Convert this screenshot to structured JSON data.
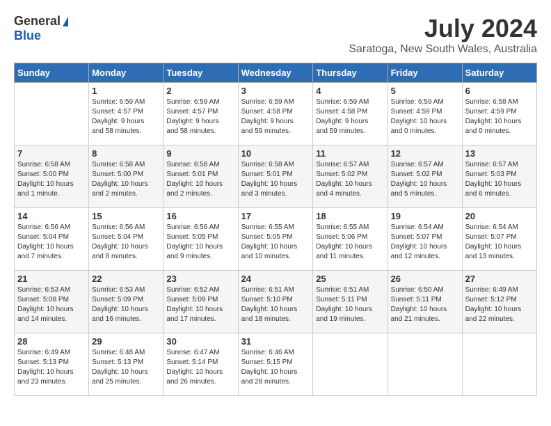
{
  "logo": {
    "general": "General",
    "blue": "Blue"
  },
  "title": {
    "month_year": "July 2024",
    "location": "Saratoga, New South Wales, Australia"
  },
  "days_header": [
    "Sunday",
    "Monday",
    "Tuesday",
    "Wednesday",
    "Thursday",
    "Friday",
    "Saturday"
  ],
  "weeks": [
    [
      {
        "day": "",
        "info": ""
      },
      {
        "day": "1",
        "info": "Sunrise: 6:59 AM\nSunset: 4:57 PM\nDaylight: 9 hours\nand 58 minutes."
      },
      {
        "day": "2",
        "info": "Sunrise: 6:59 AM\nSunset: 4:57 PM\nDaylight: 9 hours\nand 58 minutes."
      },
      {
        "day": "3",
        "info": "Sunrise: 6:59 AM\nSunset: 4:58 PM\nDaylight: 9 hours\nand 59 minutes."
      },
      {
        "day": "4",
        "info": "Sunrise: 6:59 AM\nSunset: 4:58 PM\nDaylight: 9 hours\nand 59 minutes."
      },
      {
        "day": "5",
        "info": "Sunrise: 6:59 AM\nSunset: 4:59 PM\nDaylight: 10 hours\nand 0 minutes."
      },
      {
        "day": "6",
        "info": "Sunrise: 6:58 AM\nSunset: 4:59 PM\nDaylight: 10 hours\nand 0 minutes."
      }
    ],
    [
      {
        "day": "7",
        "info": "Sunrise: 6:58 AM\nSunset: 5:00 PM\nDaylight: 10 hours\nand 1 minute."
      },
      {
        "day": "8",
        "info": "Sunrise: 6:58 AM\nSunset: 5:00 PM\nDaylight: 10 hours\nand 2 minutes."
      },
      {
        "day": "9",
        "info": "Sunrise: 6:58 AM\nSunset: 5:01 PM\nDaylight: 10 hours\nand 2 minutes."
      },
      {
        "day": "10",
        "info": "Sunrise: 6:58 AM\nSunset: 5:01 PM\nDaylight: 10 hours\nand 3 minutes."
      },
      {
        "day": "11",
        "info": "Sunrise: 6:57 AM\nSunset: 5:02 PM\nDaylight: 10 hours\nand 4 minutes."
      },
      {
        "day": "12",
        "info": "Sunrise: 6:57 AM\nSunset: 5:02 PM\nDaylight: 10 hours\nand 5 minutes."
      },
      {
        "day": "13",
        "info": "Sunrise: 6:57 AM\nSunset: 5:03 PM\nDaylight: 10 hours\nand 6 minutes."
      }
    ],
    [
      {
        "day": "14",
        "info": "Sunrise: 6:56 AM\nSunset: 5:04 PM\nDaylight: 10 hours\nand 7 minutes."
      },
      {
        "day": "15",
        "info": "Sunrise: 6:56 AM\nSunset: 5:04 PM\nDaylight: 10 hours\nand 8 minutes."
      },
      {
        "day": "16",
        "info": "Sunrise: 6:56 AM\nSunset: 5:05 PM\nDaylight: 10 hours\nand 9 minutes."
      },
      {
        "day": "17",
        "info": "Sunrise: 6:55 AM\nSunset: 5:05 PM\nDaylight: 10 hours\nand 10 minutes."
      },
      {
        "day": "18",
        "info": "Sunrise: 6:55 AM\nSunset: 5:06 PM\nDaylight: 10 hours\nand 11 minutes."
      },
      {
        "day": "19",
        "info": "Sunrise: 6:54 AM\nSunset: 5:07 PM\nDaylight: 10 hours\nand 12 minutes."
      },
      {
        "day": "20",
        "info": "Sunrise: 6:54 AM\nSunset: 5:07 PM\nDaylight: 10 hours\nand 13 minutes."
      }
    ],
    [
      {
        "day": "21",
        "info": "Sunrise: 6:53 AM\nSunset: 5:08 PM\nDaylight: 10 hours\nand 14 minutes."
      },
      {
        "day": "22",
        "info": "Sunrise: 6:53 AM\nSunset: 5:09 PM\nDaylight: 10 hours\nand 16 minutes."
      },
      {
        "day": "23",
        "info": "Sunrise: 6:52 AM\nSunset: 5:09 PM\nDaylight: 10 hours\nand 17 minutes."
      },
      {
        "day": "24",
        "info": "Sunrise: 6:51 AM\nSunset: 5:10 PM\nDaylight: 10 hours\nand 18 minutes."
      },
      {
        "day": "25",
        "info": "Sunrise: 6:51 AM\nSunset: 5:11 PM\nDaylight: 10 hours\nand 19 minutes."
      },
      {
        "day": "26",
        "info": "Sunrise: 6:50 AM\nSunset: 5:11 PM\nDaylight: 10 hours\nand 21 minutes."
      },
      {
        "day": "27",
        "info": "Sunrise: 6:49 AM\nSunset: 5:12 PM\nDaylight: 10 hours\nand 22 minutes."
      }
    ],
    [
      {
        "day": "28",
        "info": "Sunrise: 6:49 AM\nSunset: 5:13 PM\nDaylight: 10 hours\nand 23 minutes."
      },
      {
        "day": "29",
        "info": "Sunrise: 6:48 AM\nSunset: 5:13 PM\nDaylight: 10 hours\nand 25 minutes."
      },
      {
        "day": "30",
        "info": "Sunrise: 6:47 AM\nSunset: 5:14 PM\nDaylight: 10 hours\nand 26 minutes."
      },
      {
        "day": "31",
        "info": "Sunrise: 6:46 AM\nSunset: 5:15 PM\nDaylight: 10 hours\nand 28 minutes."
      },
      {
        "day": "",
        "info": ""
      },
      {
        "day": "",
        "info": ""
      },
      {
        "day": "",
        "info": ""
      }
    ]
  ]
}
